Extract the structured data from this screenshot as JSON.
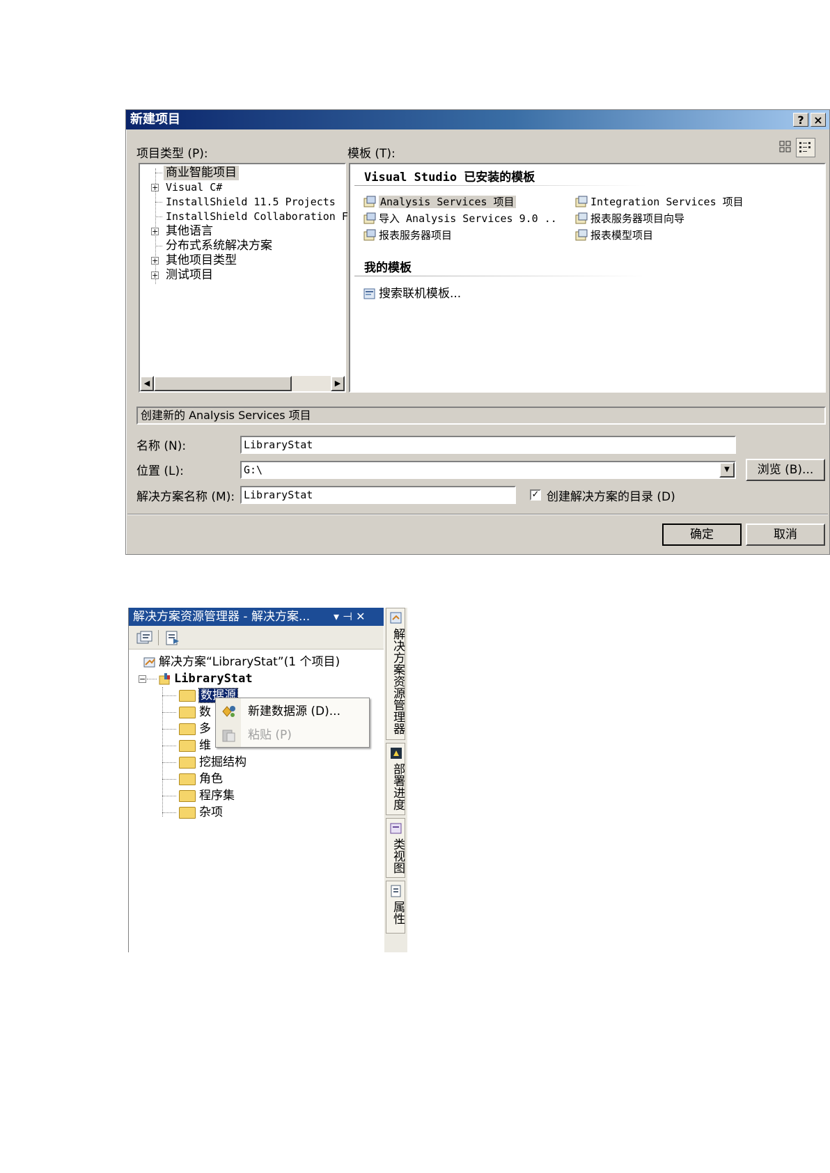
{
  "dialog": {
    "title": "新建项目",
    "help_button": "?",
    "close_button": "×",
    "project_types_label": "项目类型 (P):",
    "templates_label": "模板 (T):",
    "project_types": [
      {
        "label": "商业智能项目",
        "expandable": false,
        "selected": true
      },
      {
        "label": "Visual C#",
        "expandable": true
      },
      {
        "label": "InstallShield 11.5 Projects",
        "expandable": false
      },
      {
        "label": "InstallShield Collaboration F",
        "expandable": false
      },
      {
        "label": "其他语言",
        "expandable": true
      },
      {
        "label": "分布式系统解决方案",
        "expandable": false
      },
      {
        "label": "其他项目类型",
        "expandable": true
      },
      {
        "label": "测试项目",
        "expandable": true
      }
    ],
    "installed_heading": "Visual Studio 已安装的模板",
    "templates_left": [
      "Analysis Services 项目",
      "导入 Analysis Services 9.0 ..",
      "报表服务器项目"
    ],
    "templates_right": [
      "Integration Services 项目",
      "报表服务器项目向导",
      "报表模型项目"
    ],
    "my_templates_heading": "我的模板",
    "search_online": "搜索联机模板...",
    "description": "创建新的 Analysis Services 项目",
    "name_label": "名称 (N):",
    "name_value": "LibraryStat",
    "location_label": "位置 (L):",
    "location_value": "G:\\",
    "browse_button": "浏览 (B)...",
    "solution_label": "解决方案名称 (M):",
    "solution_value": "LibraryStat",
    "create_dir_label": "创建解决方案的目录 (D)",
    "create_dir_checked": true,
    "ok_button": "确定",
    "cancel_button": "取消"
  },
  "explorer": {
    "title": "解决方案资源管理器 - 解决方案...",
    "title_controls": "▾ ⊣ ✕",
    "solution_node": "解决方案“LibraryStat”(1 个项目)",
    "project_node": "LibraryStat",
    "folders": [
      "数据源",
      "数",
      "多",
      "维",
      "挖掘结构",
      "角色",
      "程序集",
      "杂项"
    ],
    "context_menu": {
      "new_datasource": "新建数据源 (D)...",
      "paste": "粘贴 (P)"
    },
    "side_tabs": [
      "解决方案资源管理器",
      "部署进度",
      "类视图",
      "属性"
    ]
  }
}
